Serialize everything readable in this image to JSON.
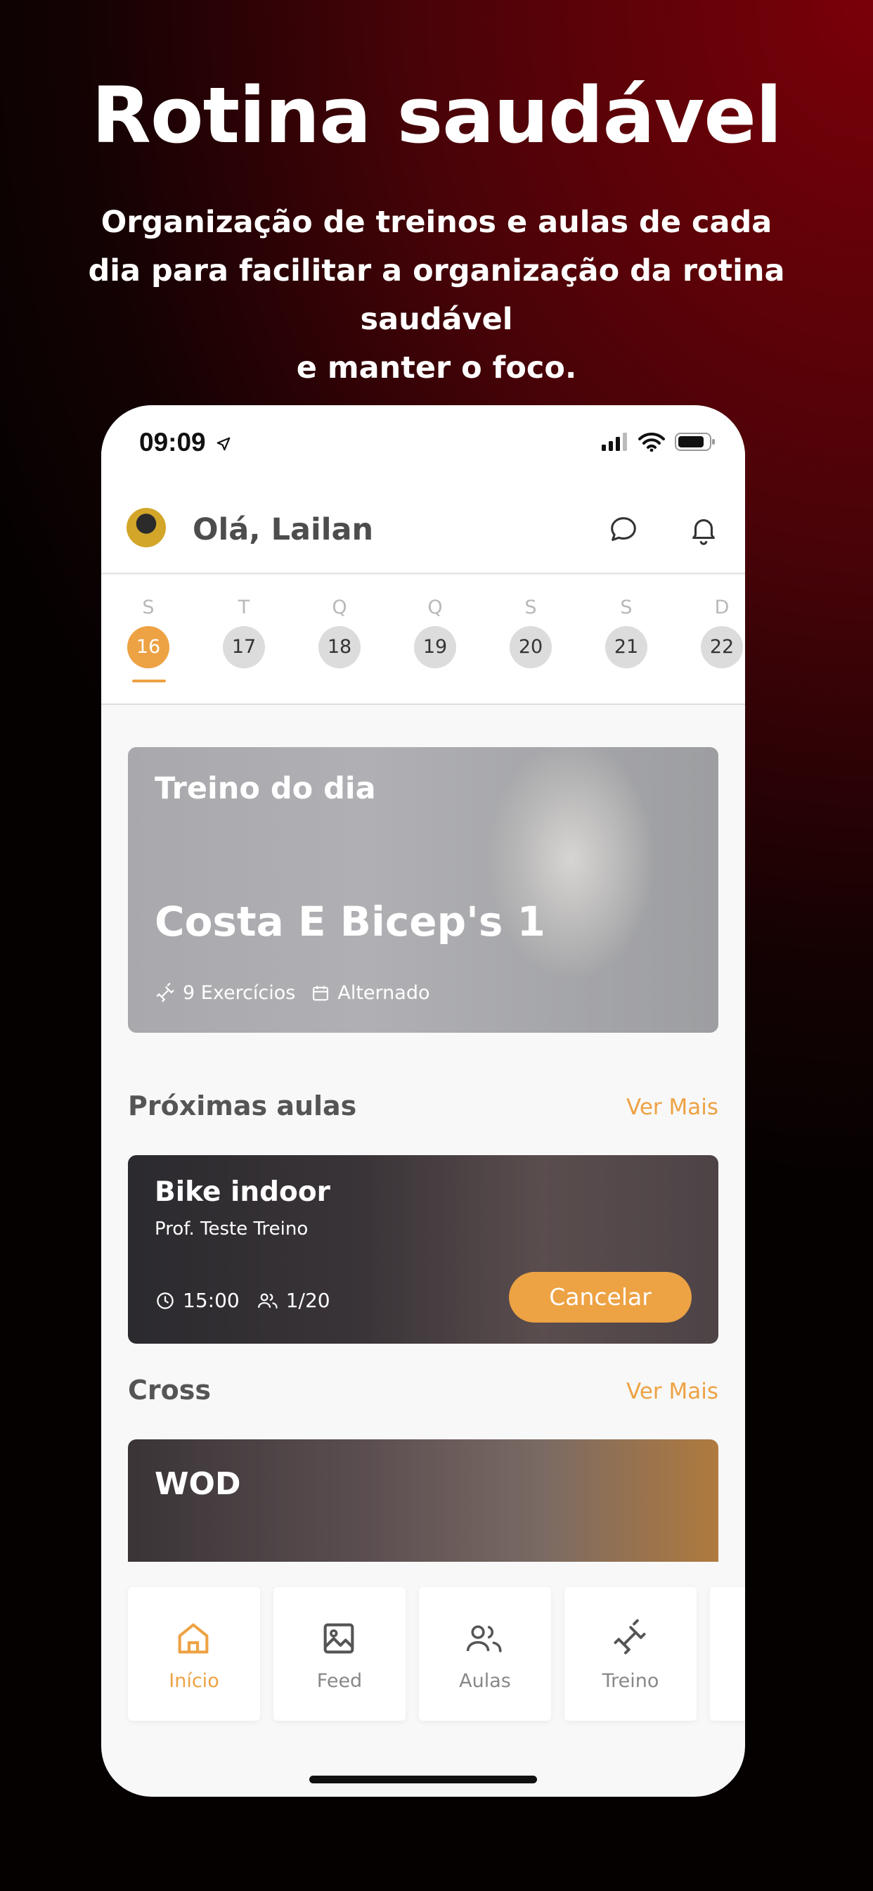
{
  "promo": {
    "title": "Rotina saudável",
    "subtitle_lines": [
      "Organização de treinos e aulas de cada",
      "dia para facilitar a organização da rotina saudável",
      "e manter o foco."
    ]
  },
  "status_bar": {
    "time": "09:09"
  },
  "header": {
    "greeting": "Olá, Lailan"
  },
  "week": {
    "days": [
      {
        "letter": "S",
        "number": "16"
      },
      {
        "letter": "T",
        "number": "17"
      },
      {
        "letter": "Q",
        "number": "18"
      },
      {
        "letter": "Q",
        "number": "19"
      },
      {
        "letter": "S",
        "number": "20"
      },
      {
        "letter": "S",
        "number": "21"
      },
      {
        "letter": "D",
        "number": "22"
      }
    ],
    "selected_index": 0
  },
  "treino_do_dia": {
    "eyebrow": "Treino do dia",
    "name": "Costa E Bicep's 1",
    "exercises": "9 Exercícios",
    "schedule": "Alternado"
  },
  "proximas_aulas": {
    "title": "Próximas aulas",
    "link": "Ver Mais",
    "card": {
      "title": "Bike indoor",
      "professor": "Prof. Teste Treino",
      "time": "15:00",
      "spots": "1/20",
      "action": "Cancelar"
    }
  },
  "cross": {
    "title": "Cross",
    "link": "Ver Mais",
    "card_title": "WOD"
  },
  "tabbar": {
    "items": [
      {
        "label": "Início",
        "icon": "home-icon"
      },
      {
        "label": "Feed",
        "icon": "image-icon"
      },
      {
        "label": "Aulas",
        "icon": "users-icon"
      },
      {
        "label": "Treino",
        "icon": "dumbbell-icon"
      }
    ]
  },
  "colors": {
    "accent": "#eda244",
    "background_dark": "#4a0308"
  }
}
